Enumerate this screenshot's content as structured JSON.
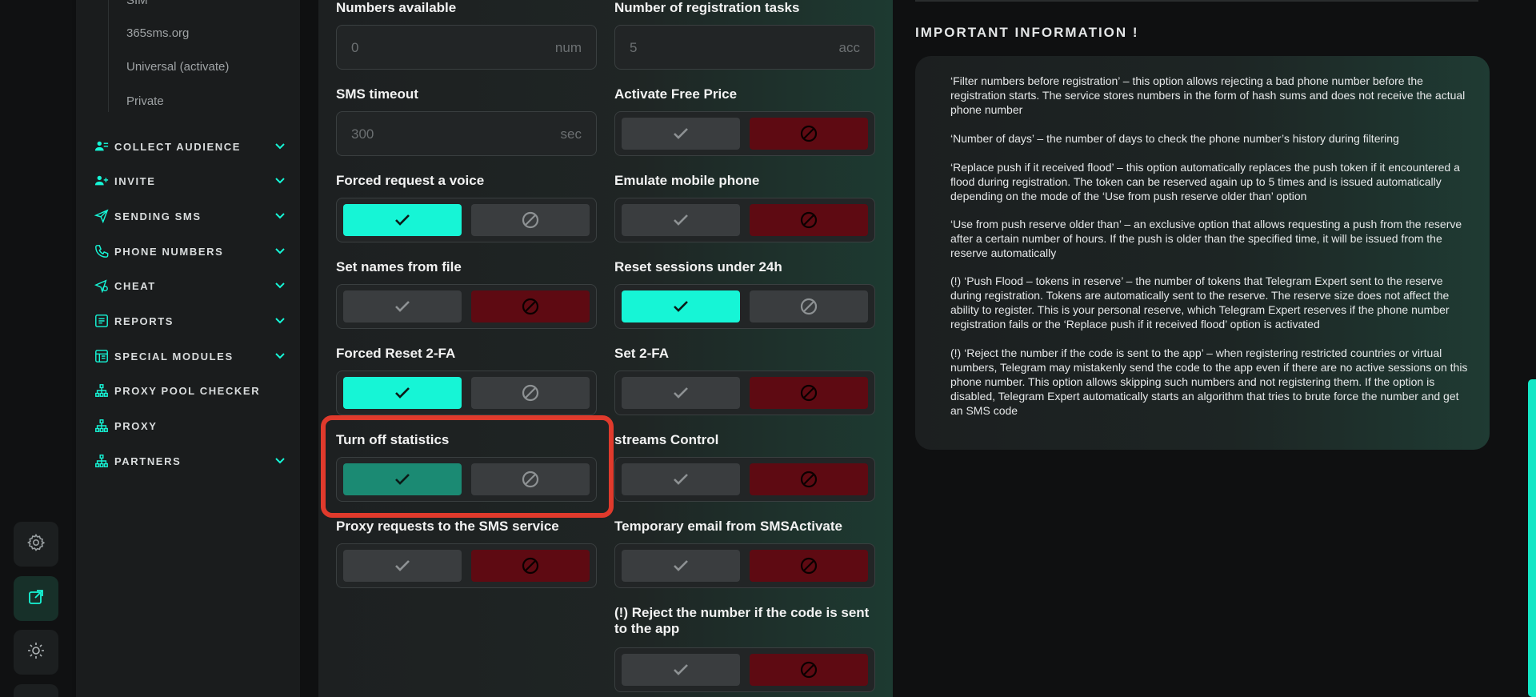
{
  "sidebar": {
    "sub_items": [
      "SIM",
      "365sms.org",
      "Universal (activate)",
      "Private"
    ],
    "nav": [
      {
        "label": "COLLECT AUDIENCE",
        "icon": "users-icon",
        "chevron": true
      },
      {
        "label": "INVITE",
        "icon": "user-plus-icon",
        "chevron": true
      },
      {
        "label": "SENDING SMS",
        "icon": "send-icon",
        "chevron": true
      },
      {
        "label": "PHONE NUMBERS",
        "icon": "phone-icon",
        "chevron": true
      },
      {
        "label": "CHEAT",
        "icon": "cheat-icon",
        "chevron": true
      },
      {
        "label": "REPORTS",
        "icon": "reports-icon",
        "chevron": true
      },
      {
        "label": "SPECIAL MODULES",
        "icon": "modules-icon",
        "chevron": true
      },
      {
        "label": "PROXY POOL CHECKER",
        "icon": "network-icon",
        "chevron": false
      },
      {
        "label": "PROXY",
        "icon": "network-icon",
        "chevron": false
      },
      {
        "label": "PARTNERS",
        "icon": "network-icon",
        "chevron": true
      }
    ]
  },
  "rail": [
    "settings-icon",
    "external-link-icon",
    "theme-icon"
  ],
  "form": {
    "numbers_available": {
      "label": "Numbers available",
      "value": "0",
      "unit": "num"
    },
    "registration_tasks": {
      "label": "Number of registration tasks",
      "value": "5",
      "unit": "acc"
    },
    "sms_timeout": {
      "label": "SMS timeout",
      "value": "300",
      "unit": "sec"
    },
    "toggles": [
      {
        "label": "Activate Free Price",
        "state": "no"
      },
      {
        "label": "Forced request a voice",
        "state": "yes"
      },
      {
        "label": "Emulate mobile phone",
        "state": "no"
      },
      {
        "label": "Set names from file",
        "state": "no"
      },
      {
        "label": "Reset sessions under 24h",
        "state": "yes"
      },
      {
        "label": "Forced Reset 2-FA",
        "state": "yes"
      },
      {
        "label": "Set 2-FA",
        "state": "no"
      },
      {
        "label": "Turn off statistics",
        "state": "yes-dim"
      },
      {
        "label": "streams Control",
        "state": "no"
      },
      {
        "label": "Proxy requests to the SMS service",
        "state": "no"
      },
      {
        "label": "Temporary email from SMSActivate",
        "state": "no"
      },
      {
        "label": "(!) Reject the number if the code is sent to the app",
        "state": "no"
      }
    ]
  },
  "info": {
    "heading": "IMPORTANT INFORMATION !",
    "paragraphs": [
      "‘Filter numbers before registration’ – this option allows rejecting a bad phone number before the registration starts. The service stores numbers in the form of hash sums and does not receive the actual phone number",
      "‘Number of days’ – the number of days to check the phone number’s history during filtering",
      "‘Replace push if it received flood’ – this option automatically replaces the push token if it encountered a flood during registration. The token can be reserved again up to 5 times and is issued automatically depending on the mode of the ‘Use from push reserve older than’ option",
      "‘Use from push reserve older than’ – an exclusive option that allows requesting a push from the reserve after a certain number of hours. If the push is older than the specified time, it will be issued from the reserve automatically",
      "(!) ‘Push Flood – tokens in reserve’ – the number of tokens that Telegram Expert sent to the reserve during registration. Tokens are automatically sent to the reserve. The reserve size does not affect the ability to register. This is your personal reserve, which Telegram Expert reserves if the phone number registration fails or the ‘Replace push if it received flood’ option is activated",
      "(!) ‘Reject the number if the code is sent to the app’ – when registering restricted countries or virtual numbers, Telegram may mistakenly send the code to the app even if there are no active sessions on this phone number. This option allows skipping such numbers and not registering them. If the option is disabled, Telegram Expert automatically starts an algorithm that tries to brute force the number and get an SMS code"
    ]
  },
  "colors": {
    "accent": "#16f5d6",
    "danger": "#5e0a12",
    "highlight": "#e03a2c"
  }
}
